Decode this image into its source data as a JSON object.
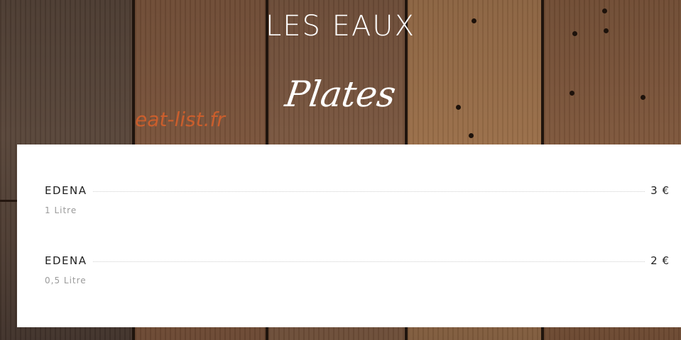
{
  "section_title": "LES EAUX",
  "category": "Plates",
  "watermark": "eat-list.fr",
  "items": [
    {
      "name": "EDENA",
      "price": "3 €",
      "description": "1 Litre"
    },
    {
      "name": "EDENA",
      "price": "2 €",
      "description": "0,5 Litre"
    }
  ]
}
